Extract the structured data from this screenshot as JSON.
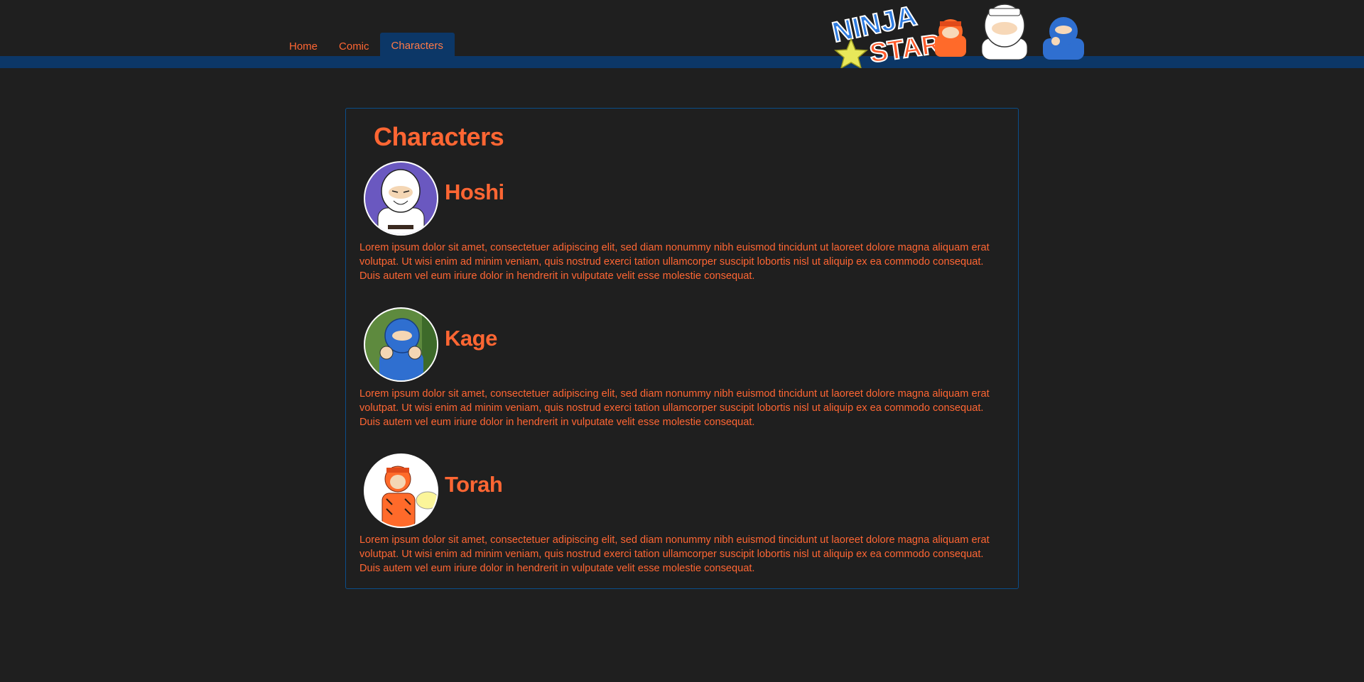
{
  "nav": {
    "items": [
      {
        "label": "Home"
      },
      {
        "label": "Comic"
      },
      {
        "label": "Characters"
      }
    ],
    "active": "Characters"
  },
  "logo": {
    "word1": "NINJA",
    "word2": "STAR"
  },
  "main": {
    "title": "Characters",
    "characters": [
      {
        "name": "Hoshi",
        "description": "Lorem ipsum dolor sit amet, consectetuer adipiscing elit, sed diam nonummy nibh euismod tincidunt ut laoreet dolore magna aliquam erat volutpat. Ut wisi enim ad minim veniam, quis nostrud exerci tation ullamcorper suscipit lobortis nisl ut aliquip ex ea commodo consequat. Duis autem vel eum iriure dolor in hendrerit in vulputate velit esse molestie consequat."
      },
      {
        "name": "Kage",
        "description": "Lorem ipsum dolor sit amet, consectetuer adipiscing elit, sed diam nonummy nibh euismod tincidunt ut laoreet dolore magna aliquam erat volutpat. Ut wisi enim ad minim veniam, quis nostrud exerci tation ullamcorper suscipit lobortis nisl ut aliquip ex ea commodo consequat. Duis autem vel eum iriure dolor in hendrerit in vulputate velit esse molestie consequat."
      },
      {
        "name": "Torah",
        "description": "Lorem ipsum dolor sit amet, consectetuer adipiscing elit, sed diam nonummy nibh euismod tincidunt ut laoreet dolore magna aliquam erat volutpat. Ut wisi enim ad minim veniam, quis nostrud exerci tation ullamcorper suscipit lobortis nisl ut aliquip ex ea commodo consequat. Duis autem vel eum iriure dolor in hendrerit in vulputate velit esse molestie consequat."
      }
    ]
  },
  "colors": {
    "background": "#1f1f1f",
    "accent": "#ff6633",
    "nav_bar": "#0c3767",
    "panel_border": "#0a4e8a"
  }
}
